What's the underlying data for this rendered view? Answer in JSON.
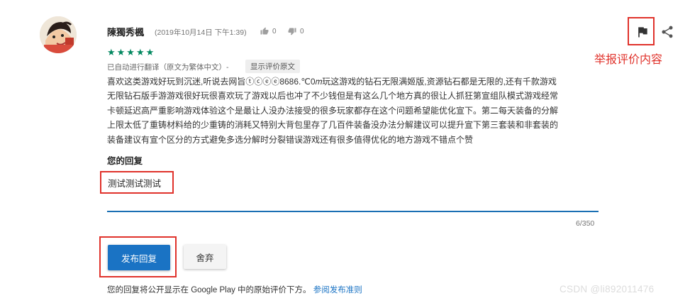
{
  "review": {
    "author": "陳獨秀楓",
    "date": "(2019年10月14日 下午1:39)",
    "likes": "0",
    "dislikes": "0",
    "stars": "★★★★★",
    "rating": 5,
    "translation_note": "已自动进行翻译（原文为繁体中文）-",
    "show_original_label": "显示评价原文",
    "text_lines": [
      "喜欢这类游戏好玩到沉迷,听说去网旨ⓣⓒⓔⓔ8686.℃0𝑚玩这游戏的钻石无限满姬版,资源钻石都是无限的,还有千款游戏",
      "无限钻石版手游游戏很好玩很喜欢玩了游戏以后也冲了不少钱但是有这么几个地方真的很让人抓狂第宣组队模式游戏经常",
      "卡顿延迟高严重影响游戏体验这个是最让人没办法接受的很多玩家都存在这个问题希望能优化宣下。第二每天装备的分解",
      "上限太低了重铸材料给的少重铸的消耗又特别大背包里存了几百件装备没办法分解建议可以提升宣下第三套装和非套装的",
      "装备建议有宣个区分的方式避免多选分解时分裂错误游戏还有很多值得优化的地方游戏不错点个赞"
    ]
  },
  "reply": {
    "heading": "您的回复",
    "text": "测试测试测试",
    "char_count": "6/350",
    "publish_label": "发布回复",
    "discard_label": "舍弃",
    "footer_text": "您的回复将公开显示在 Google Play 中的原始评价下方。",
    "guidelines_link": "参阅发布准则"
  },
  "annotation": {
    "report_label": "举报评价内容"
  },
  "watermark": "CSDN @li892011476",
  "icons": {
    "thumb_up": "thumb-up-icon",
    "thumb_down": "thumb-down-icon",
    "flag": "flag-icon",
    "share": "share-icon"
  },
  "colors": {
    "star": "#01875f",
    "accent": "#1a73c4",
    "annotation_red": "#e0322b"
  }
}
